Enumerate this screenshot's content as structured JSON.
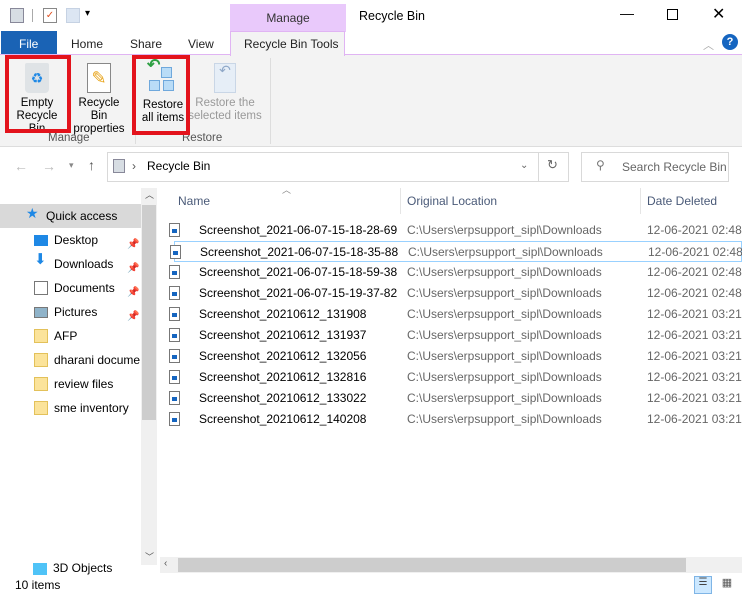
{
  "window": {
    "title": "Recycle Bin",
    "context_tab_group": "Manage"
  },
  "ribbon_tabs": [
    "File",
    "Home",
    "Share",
    "View",
    "Recycle Bin Tools"
  ],
  "ribbon": {
    "manage": {
      "label": "Manage",
      "buttons": [
        {
          "line1": "Empty",
          "line2": "Recycle Bin"
        },
        {
          "line1": "Recycle Bin",
          "line2": "properties"
        }
      ]
    },
    "restore": {
      "label": "Restore",
      "buttons": [
        {
          "line1": "Restore",
          "line2": "all items"
        },
        {
          "line1": "Restore the",
          "line2": "selected items",
          "disabled": true
        }
      ]
    }
  },
  "address": {
    "path": "Recycle Bin",
    "search_placeholder": "Search Recycle Bin"
  },
  "nav": {
    "items": [
      {
        "label": "Quick access",
        "icon": "star-icon",
        "selected": true
      },
      {
        "label": "Desktop",
        "icon": "desktop-icon",
        "pinned": true
      },
      {
        "label": "Downloads",
        "icon": "download-arrow-icon",
        "pinned": true
      },
      {
        "label": "Documents",
        "icon": "documents-icon",
        "pinned": true
      },
      {
        "label": "Pictures",
        "icon": "pictures-icon",
        "pinned": true
      },
      {
        "label": "AFP",
        "icon": "folder-icon"
      },
      {
        "label": "dharani docume",
        "icon": "folder-icon"
      },
      {
        "label": "review files",
        "icon": "folder-icon"
      },
      {
        "label": "sme inventory",
        "icon": "folder-icon"
      }
    ],
    "bottom_item": "3D Objects"
  },
  "columns": {
    "name": "Name",
    "location": "Original Location",
    "date": "Date Deleted"
  },
  "files": [
    {
      "name": "Screenshot_2021-06-07-15-18-28-69",
      "location": "C:\\Users\\erpsupport_sipl\\Downloads",
      "date": "12-06-2021 02:48"
    },
    {
      "name": "Screenshot_2021-06-07-15-18-35-88",
      "location": "C:\\Users\\erpsupport_sipl\\Downloads",
      "date": "12-06-2021 02:48"
    },
    {
      "name": "Screenshot_2021-06-07-15-18-59-38",
      "location": "C:\\Users\\erpsupport_sipl\\Downloads",
      "date": "12-06-2021 02:48"
    },
    {
      "name": "Screenshot_2021-06-07-15-19-37-82",
      "location": "C:\\Users\\erpsupport_sipl\\Downloads",
      "date": "12-06-2021 02:48"
    },
    {
      "name": "Screenshot_20210612_131908",
      "location": "C:\\Users\\erpsupport_sipl\\Downloads",
      "date": "12-06-2021 03:21"
    },
    {
      "name": "Screenshot_20210612_131937",
      "location": "C:\\Users\\erpsupport_sipl\\Downloads",
      "date": "12-06-2021 03:21"
    },
    {
      "name": "Screenshot_20210612_132056",
      "location": "C:\\Users\\erpsupport_sipl\\Downloads",
      "date": "12-06-2021 03:21"
    },
    {
      "name": "Screenshot_20210612_132816",
      "location": "C:\\Users\\erpsupport_sipl\\Downloads",
      "date": "12-06-2021 03:21"
    },
    {
      "name": "Screenshot_20210612_133022",
      "location": "C:\\Users\\erpsupport_sipl\\Downloads",
      "date": "12-06-2021 03:21"
    },
    {
      "name": "Screenshot_20210612_140208",
      "location": "C:\\Users\\erpsupport_sipl\\Downloads",
      "date": "12-06-2021 03:21"
    }
  ],
  "status": {
    "count": "10 items"
  },
  "colors": {
    "file_tab": "#1a63b5",
    "context_tab": "#e9c9fb",
    "highlight": "#e3131c",
    "selection": "#cce8ff"
  }
}
